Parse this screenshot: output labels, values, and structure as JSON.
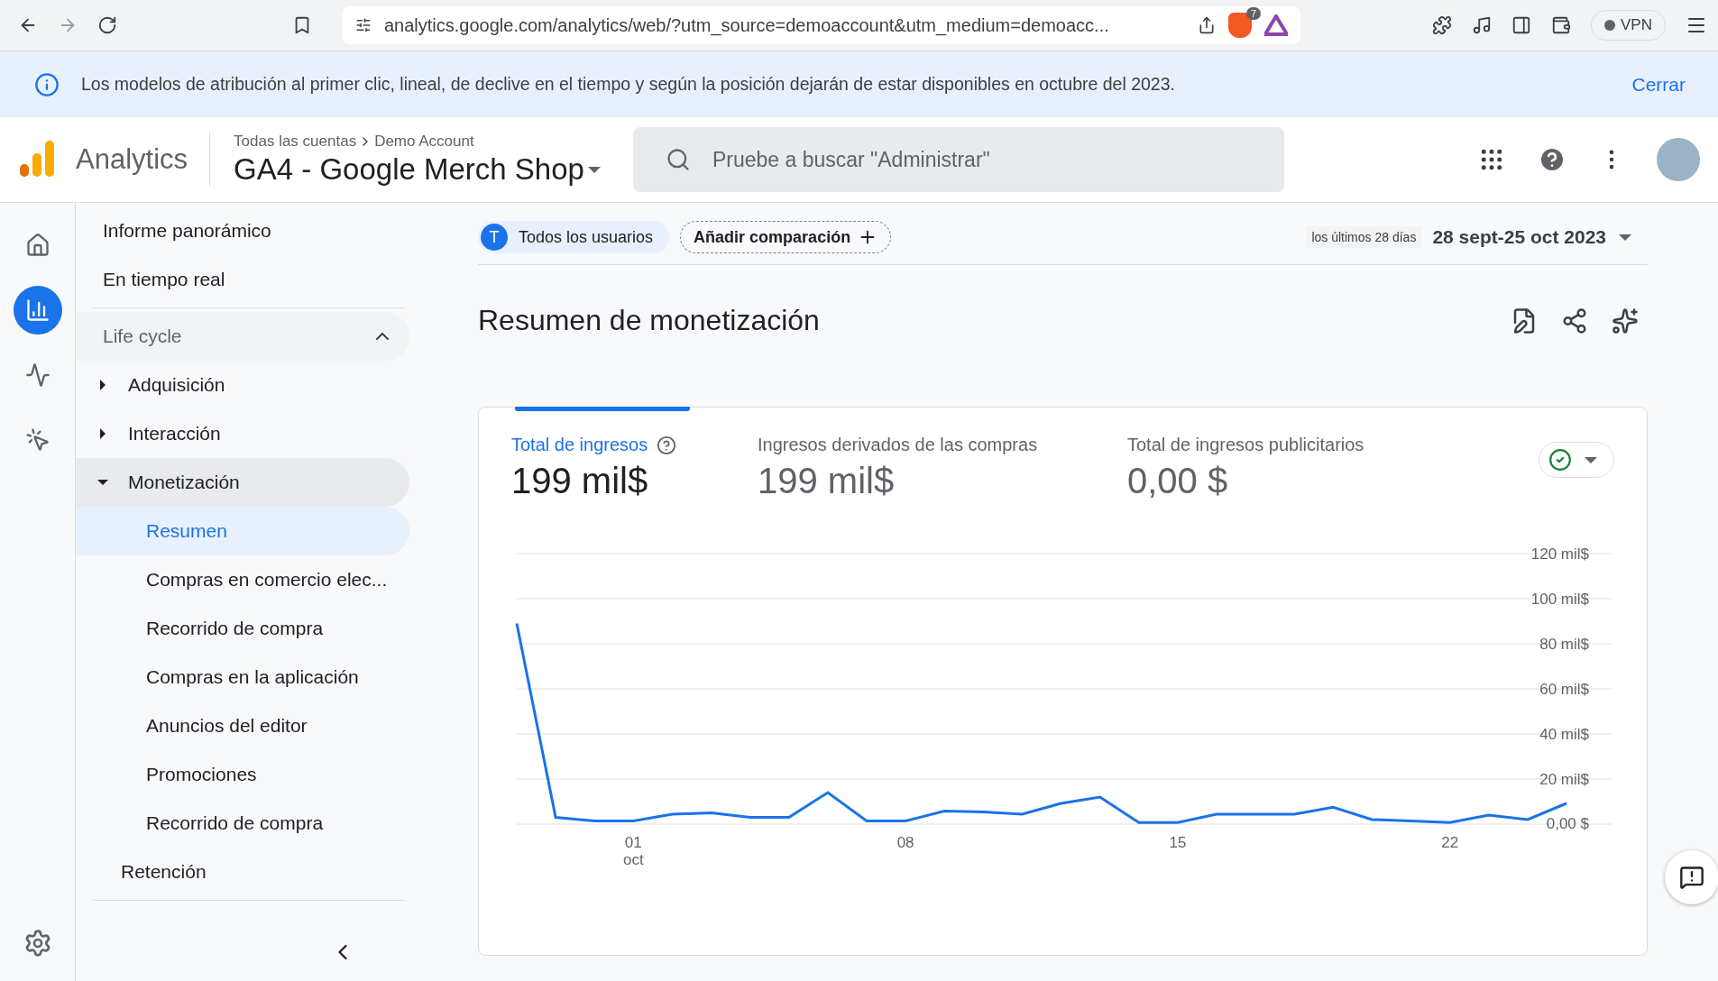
{
  "browser": {
    "url": "analytics.google.com/analytics/web/?utm_source=demoaccount&utm_medium=demoacc...",
    "shield_count": "7",
    "vpn_label": "VPN"
  },
  "banner": {
    "message": "Los modelos de atribución al primer clic, lineal, de declive en el tiempo y según la posición dejarán de estar disponibles en octubre del 2023.",
    "close_label": "Cerrar"
  },
  "header": {
    "product": "Analytics",
    "breadcrumb": [
      "Todas las cuentas",
      "Demo Account"
    ],
    "property": "GA4 - Google Merch Shop",
    "search": {
      "placeholder": "Pruebe a buscar \"Administrar\""
    }
  },
  "rail": {
    "items": [
      {
        "kind": "home",
        "selected": false
      },
      {
        "kind": "reports",
        "selected": true
      },
      {
        "kind": "explore",
        "selected": false
      },
      {
        "kind": "advertising",
        "selected": false
      }
    ]
  },
  "nav": {
    "top_items": [
      {
        "label": "Informe panorámico"
      },
      {
        "label": "En tiempo real"
      }
    ],
    "section": {
      "label": "Life cycle",
      "expanded": true
    },
    "items": [
      {
        "label": "Adquisición",
        "expanded": false
      },
      {
        "label": "Interacción",
        "expanded": false
      },
      {
        "label": "Monetización",
        "expanded": true,
        "children": [
          {
            "label": "Resumen",
            "selected": true
          },
          {
            "label": "Compras en comercio elec...",
            "selected": false
          },
          {
            "label": "Recorrido de compra",
            "selected": false
          },
          {
            "label": "Compras en la aplicación",
            "selected": false
          },
          {
            "label": "Anuncios del editor",
            "selected": false
          },
          {
            "label": "Promociones",
            "selected": false
          },
          {
            "label": "Recorrido de compra",
            "selected": false
          }
        ]
      },
      {
        "label": "Retención"
      }
    ]
  },
  "toolbar": {
    "comparison": {
      "letter": "T",
      "label": "Todos los usuarios"
    },
    "add_comparison": "Añadir comparación",
    "date_hint": "los últimos 28 días",
    "date_range": "28 sept-25 oct 2023"
  },
  "page_title": "Resumen de monetización",
  "card": {
    "metrics": [
      {
        "label": "Total de ingresos",
        "value": "199 mil$",
        "selected": true
      },
      {
        "label": "Ingresos derivados de las compras",
        "value": "199 mil$",
        "selected": false
      },
      {
        "label": "Total de ingresos publicitarios",
        "value": "0,00 $",
        "selected": false
      }
    ],
    "chart_data": {
      "type": "line",
      "categories": [
        null,
        null,
        null,
        "01 oct",
        null,
        null,
        null,
        null,
        null,
        null,
        "08",
        null,
        null,
        null,
        null,
        null,
        null,
        "15",
        null,
        null,
        null,
        null,
        null,
        null,
        "22",
        null,
        null,
        null
      ],
      "values": [
        89,
        3,
        1.4,
        1.4,
        4.4,
        5,
        3,
        3,
        14,
        1.4,
        1.4,
        5.8,
        5.4,
        4.4,
        9.2,
        12,
        0.7,
        0.7,
        4.4,
        4.4,
        4.4,
        7.5,
        2,
        1.4,
        0.7,
        4,
        2,
        9.2
      ],
      "ylim": [
        0,
        120
      ],
      "yticks": [
        {
          "value": 0,
          "label": "0,00 $"
        },
        {
          "value": 20,
          "label": "20 mil$"
        },
        {
          "value": 40,
          "label": "40 mil$"
        },
        {
          "value": 60,
          "label": "60 mil$"
        },
        {
          "value": 80,
          "label": "80 mil$"
        },
        {
          "value": 100,
          "label": "100 mil$"
        },
        {
          "value": 120,
          "label": "120 mil$"
        }
      ],
      "grid": true
    }
  }
}
